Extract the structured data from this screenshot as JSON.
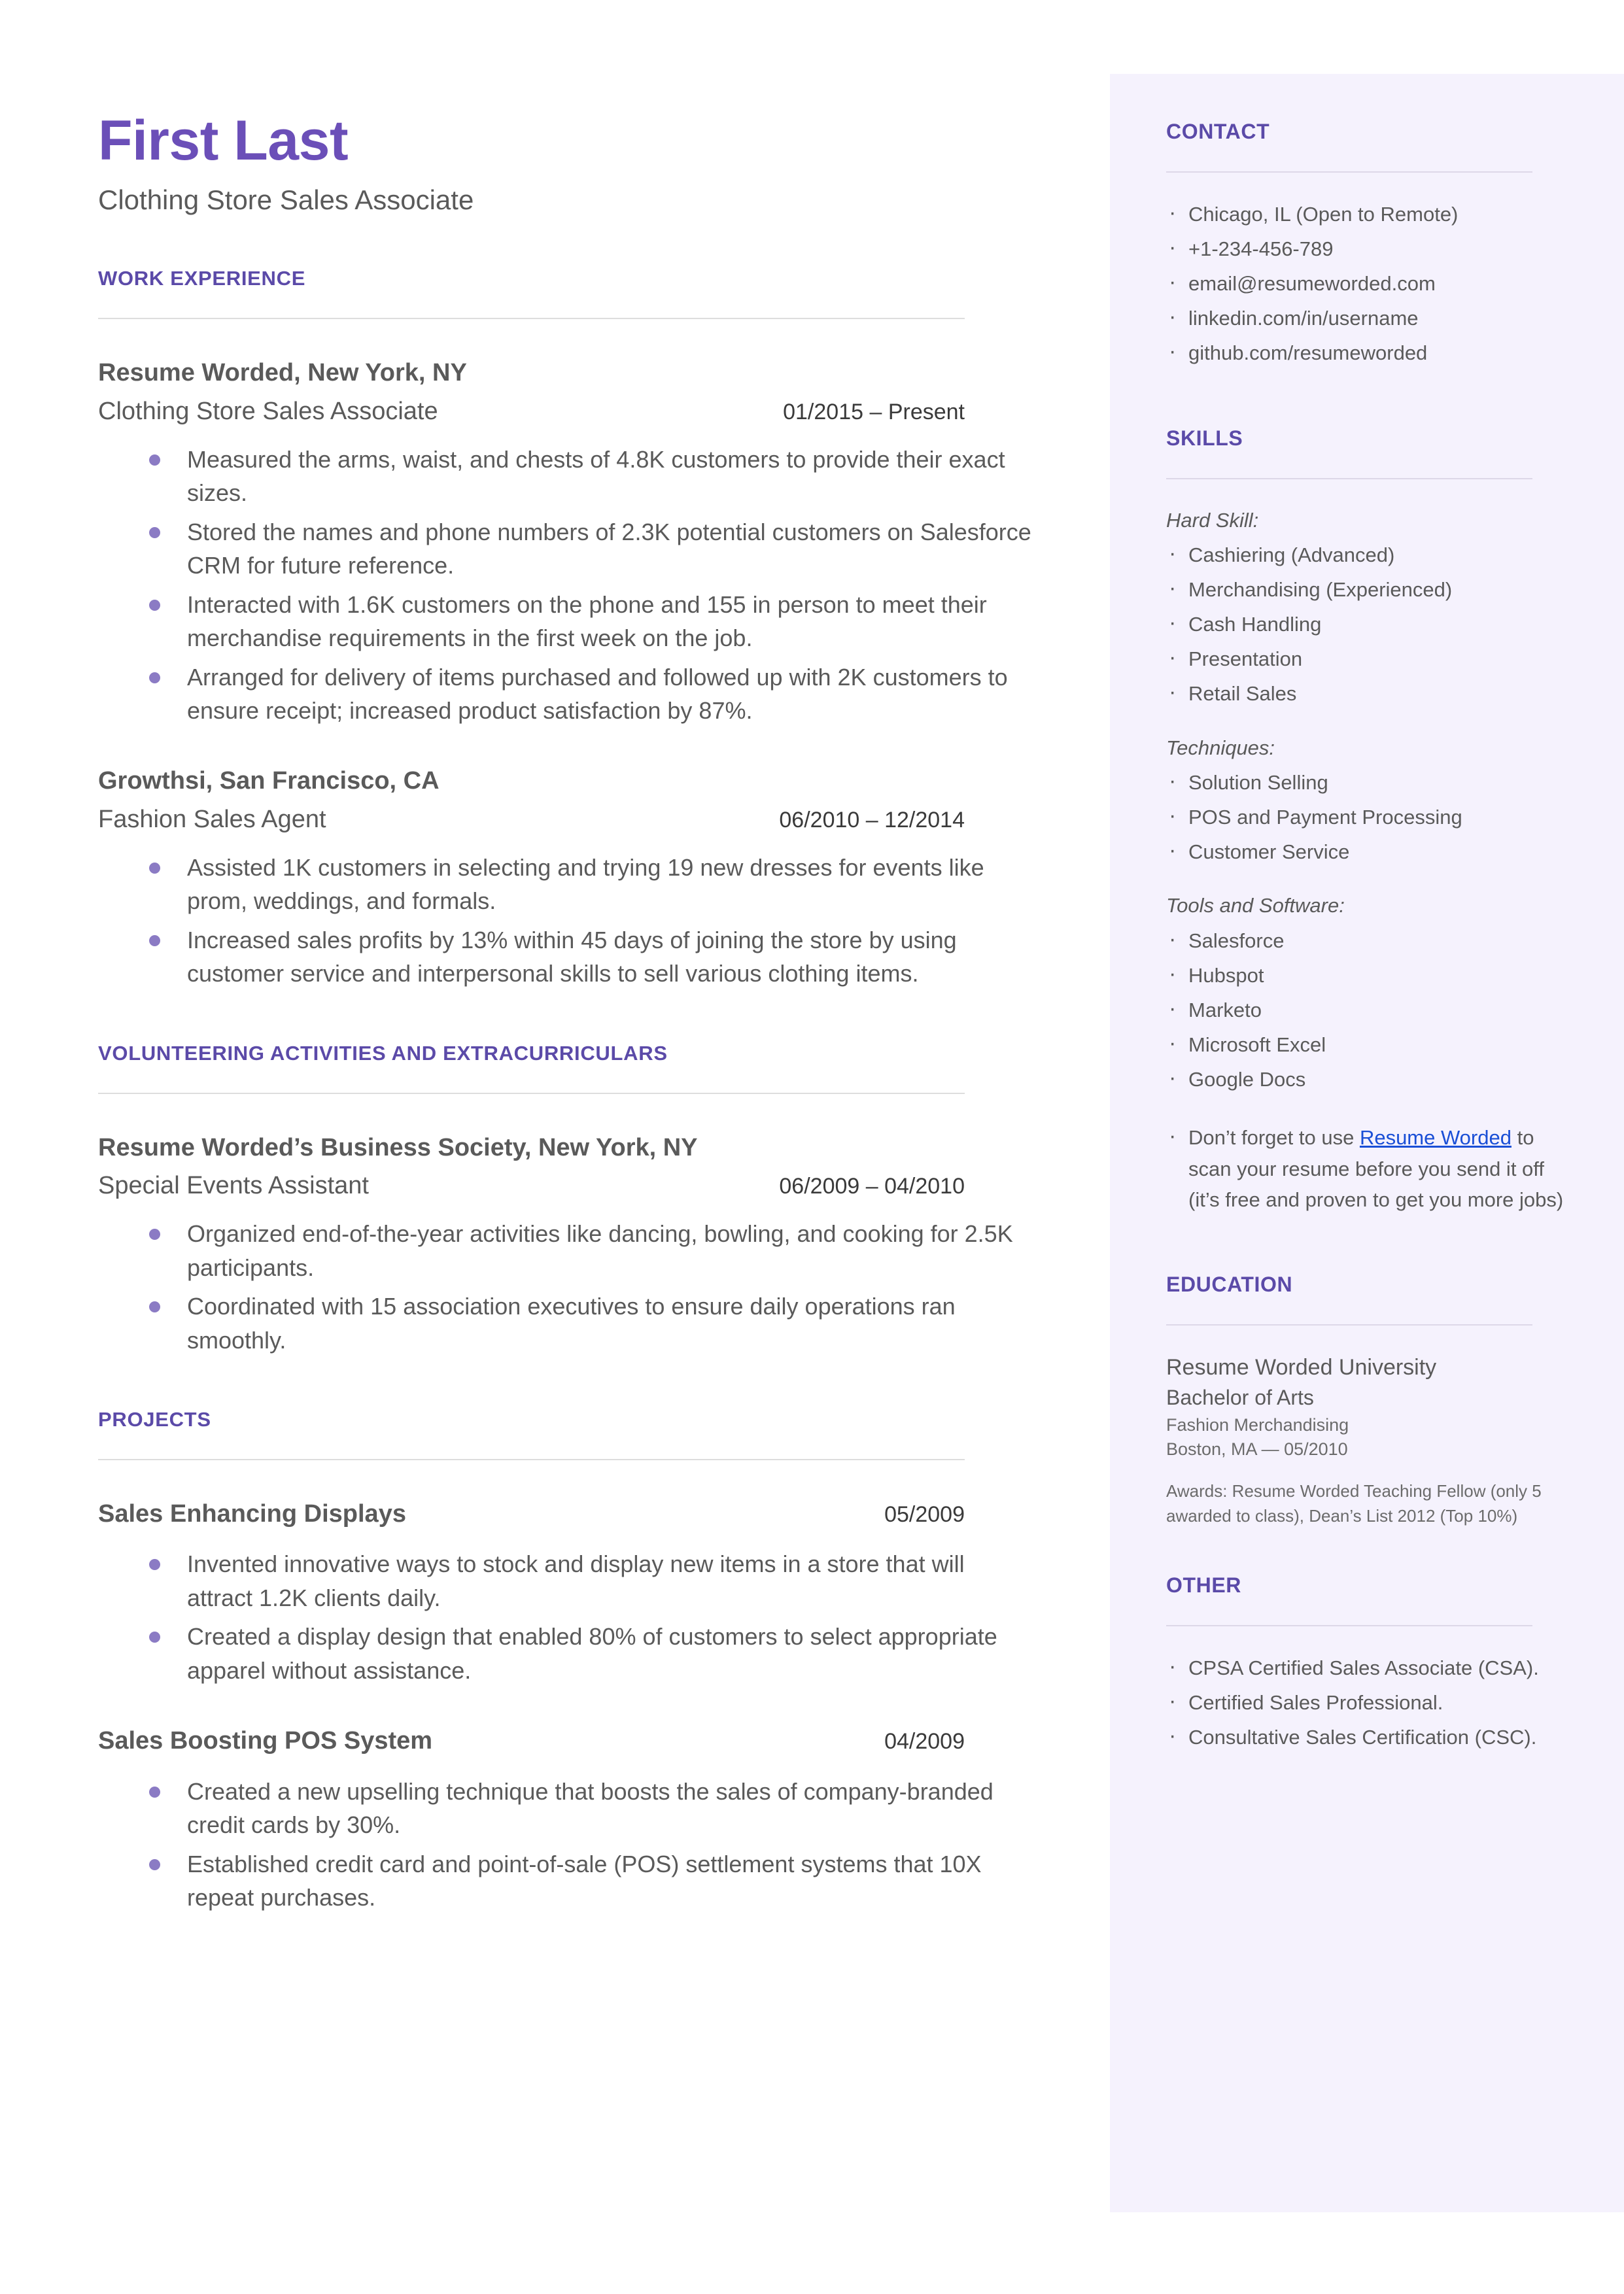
{
  "header": {
    "name": "First Last",
    "title": "Clothing Store Sales Associate"
  },
  "colors": {
    "accent_purple": "#5b4aa8",
    "name_purple": "#6b4fb8",
    "sidebar_bg": "#f5f2fd",
    "bullet_purple": "#8b7bc4",
    "link_blue": "#1a4fd6",
    "body_text": "#5a5a5a"
  },
  "main": {
    "work_experience": {
      "heading": "WORK EXPERIENCE",
      "entries": [
        {
          "org": "Resume Worded, New York, NY",
          "title": "Clothing Store Sales Associate",
          "date": "01/2015 – Present",
          "bullets": [
            "Measured the arms, waist, and chests of 4.8K customers to provide their exact sizes.",
            "Stored the names and phone numbers of 2.3K potential customers on Salesforce CRM for future reference.",
            "Interacted with 1.6K customers on the phone and 155 in person to meet their merchandise requirements in the first week on the job.",
            "Arranged for delivery of items purchased and followed up with 2K customers to ensure receipt; increased product satisfaction by 87%."
          ]
        },
        {
          "org": "Growthsi, San Francisco, CA",
          "title": "Fashion Sales Agent",
          "date": "06/2010 – 12/2014",
          "bullets": [
            "Assisted 1K customers in selecting and trying 19 new dresses for events like prom, weddings, and formals.",
            "Increased sales profits by 13% within 45 days of joining the store by using customer service and interpersonal skills to sell various clothing items."
          ]
        }
      ]
    },
    "volunteering": {
      "heading": "VOLUNTEERING ACTIVITIES AND EXTRACURRICULARS",
      "entries": [
        {
          "org": "Resume Worded’s Business Society, New York, NY",
          "title": "Special Events Assistant",
          "date": "06/2009 – 04/2010",
          "bullets": [
            "Organized end-of-the-year activities like dancing, bowling, and cooking for 2.5K participants.",
            "Coordinated with 15 association executives to ensure daily operations ran smoothly."
          ]
        }
      ]
    },
    "projects": {
      "heading": "PROJECTS",
      "entries": [
        {
          "org": "Sales Enhancing Displays",
          "date": "05/2009",
          "bullets": [
            "Invented innovative ways to stock and display new items in a store that will attract 1.2K clients daily.",
            "Created a display design that enabled 80% of customers to select appropriate apparel without assistance."
          ]
        },
        {
          "org": "Sales Boosting POS System",
          "date": "04/2009",
          "bullets": [
            "Created a new upselling technique that boosts the sales of company-branded credit cards by 30%.",
            "Established credit card and point-of-sale (POS) settlement systems that 10X repeat purchases."
          ]
        }
      ]
    }
  },
  "sidebar": {
    "contact": {
      "heading": "CONTACT",
      "items": [
        "Chicago, IL (Open to Remote)",
        "+1-234-456-789",
        "email@resumeworded.com",
        "linkedin.com/in/username",
        "github.com/resumeworded"
      ]
    },
    "skills": {
      "heading": "SKILLS",
      "groups": [
        {
          "label": "Hard Skill:",
          "items": [
            "Cashiering (Advanced)",
            "Merchandising (Experienced)",
            "Cash Handling",
            "Presentation",
            "Retail Sales"
          ]
        },
        {
          "label": "Techniques:",
          "items": [
            "Solution Selling",
            "POS and Payment Processing",
            "Customer Service"
          ]
        },
        {
          "label": "Tools and Software:",
          "items": [
            "Salesforce",
            "Hubspot",
            "Marketo",
            "Microsoft Excel",
            "Google Docs"
          ]
        }
      ],
      "promo": {
        "before": "Don’t forget to use ",
        "link": "Resume Worded",
        "after": " to scan your resume before you send it off (it’s free and proven to get you more jobs)"
      }
    },
    "education": {
      "heading": "EDUCATION",
      "school": "Resume Worded University",
      "degree": "Bachelor of Arts",
      "minor": "Fashion Merchandising",
      "location": "Boston, MA — 05/2010",
      "awards": "Awards: Resume Worded Teaching Fellow (only 5 awarded to class), Dean’s List 2012 (Top 10%)"
    },
    "other": {
      "heading": "OTHER",
      "items": [
        "CPSA Certified Sales Associate (CSA).",
        "Certified Sales Professional.",
        "Consultative Sales Certification (CSC)."
      ]
    }
  }
}
